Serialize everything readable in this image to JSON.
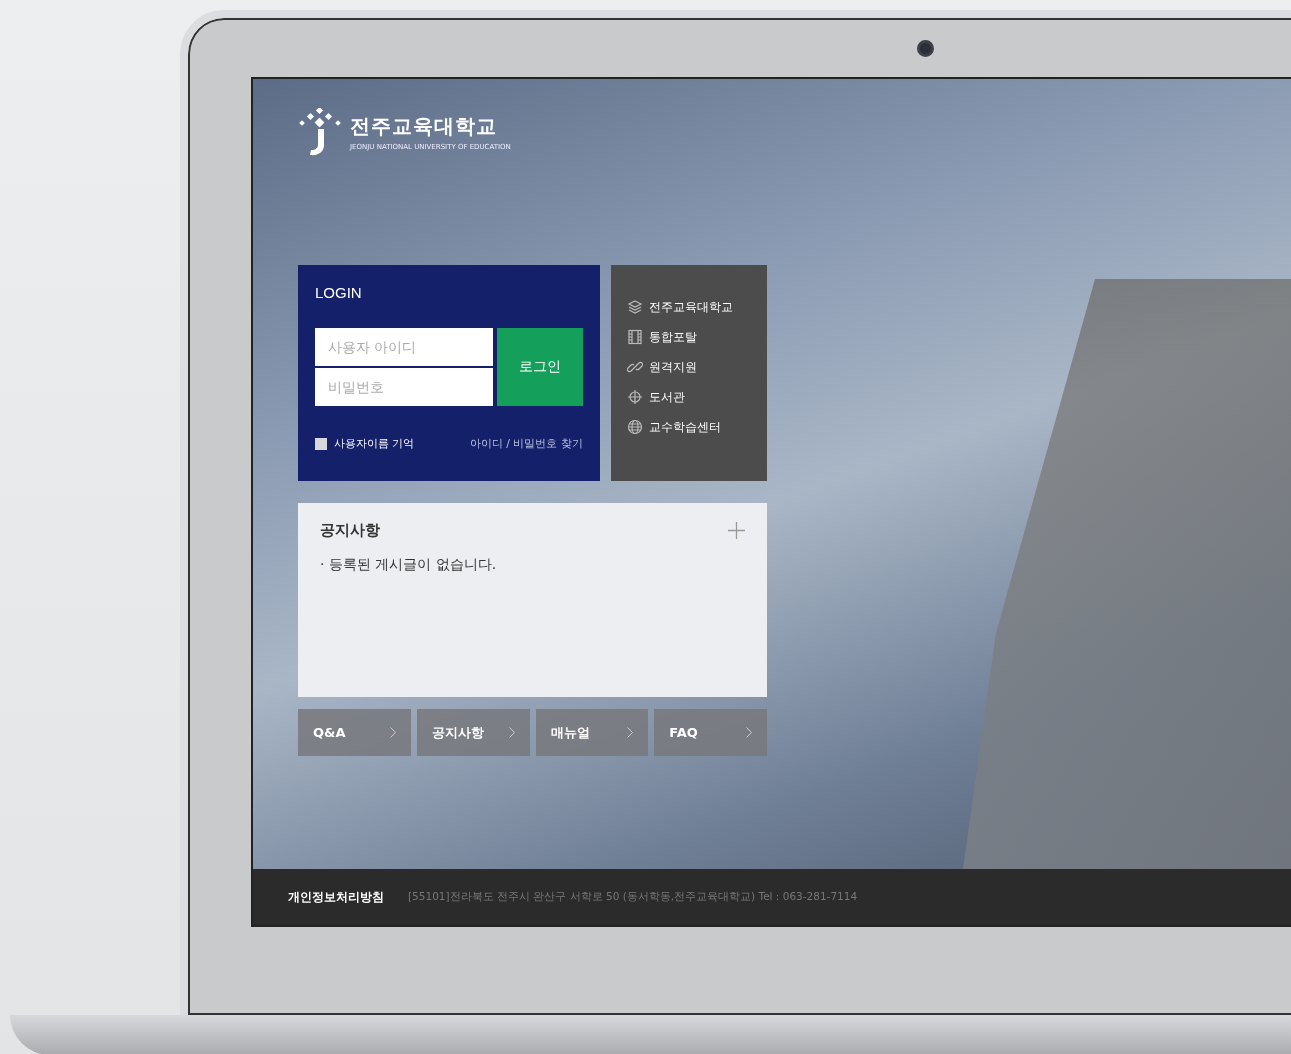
{
  "logo": {
    "name": "전주교육대학교",
    "subtitle": "JEONJU NATIONAL UNIVERSITY OF EDUCATION"
  },
  "login": {
    "title": "LOGIN",
    "id_field": {
      "placeholder": "사용자 아이디"
    },
    "password_field": {
      "placeholder": "비밀번호"
    },
    "button": "로그인",
    "remember": {
      "label": "사용자이름 기억",
      "checked": false
    },
    "find_link": "아이디 / 비밀번호 찾기"
  },
  "quick_links": [
    {
      "kind": "layers",
      "label": "전주교육대학교"
    },
    {
      "kind": "film",
      "label": "통합포탈"
    },
    {
      "kind": "link",
      "label": "원격지원"
    },
    {
      "kind": "crosshair",
      "label": "도서관"
    },
    {
      "kind": "globe",
      "label": "교수학습센터"
    }
  ],
  "notice": {
    "title": "공지사항",
    "items": [
      "· 등록된 게시글이 없습니다."
    ]
  },
  "shortcuts": [
    "Q&A",
    "공지사항",
    "매뉴얼",
    "FAQ"
  ],
  "footer": {
    "policy": "개인정보처리방침",
    "address": "[55101]전라북도 전주시 완산구 서학로 50 (동서학동,전주교육대학교)  Tel : 063-281-7114"
  }
}
